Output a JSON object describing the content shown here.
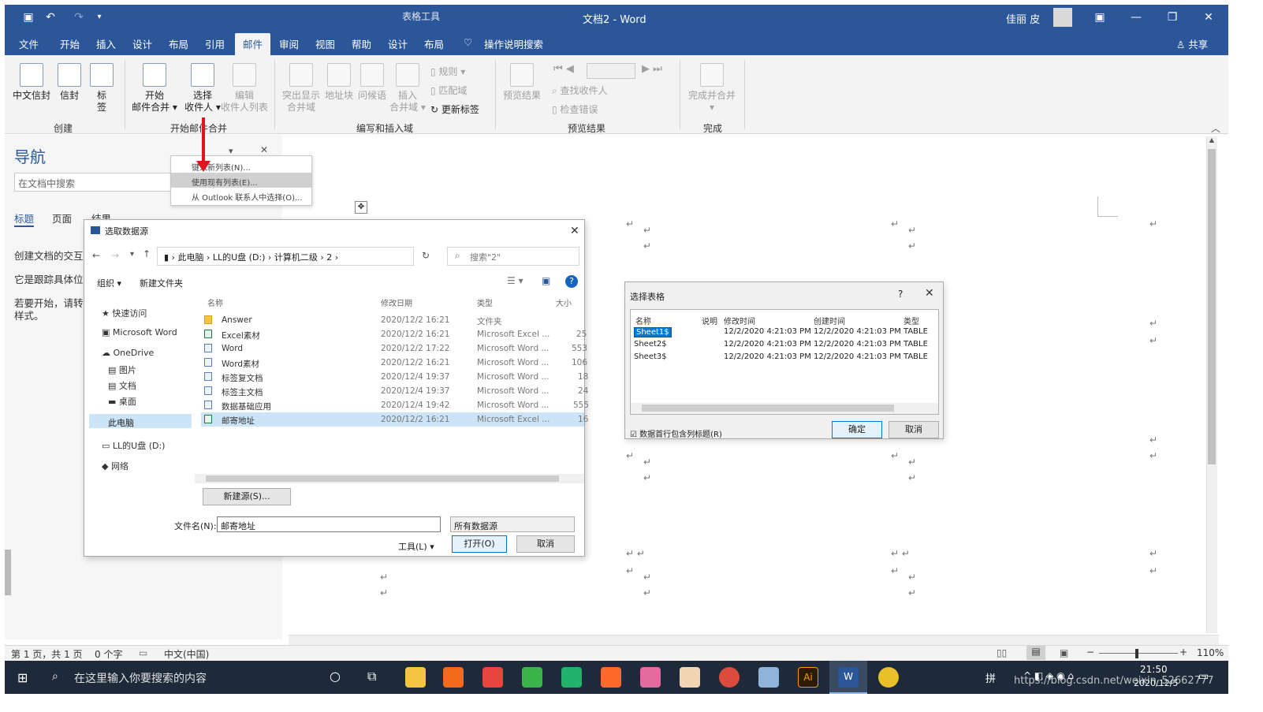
{
  "title_bar": {
    "doc_title": "文档2 - Word",
    "context_tab": "表格工具",
    "user": "佳丽 皮"
  },
  "tabs": [
    "文件",
    "开始",
    "插入",
    "设计",
    "布局",
    "引用",
    "邮件",
    "审阅",
    "视图",
    "帮助",
    "设计",
    "布局"
  ],
  "active_tab": "邮件",
  "tell_me": "操作说明搜索",
  "share": "共享",
  "ribbon": {
    "create": {
      "label": "创建",
      "btn1": "中文信封",
      "btn2": "信封",
      "btn3a": "标",
      "btn3b": "签"
    },
    "start": {
      "label": "开始邮件合并",
      "btn1a": "开始",
      "btn1b": "邮件合并 ▾",
      "btn2a": "选择",
      "btn2b": "收件人 ▾",
      "btn3a": "编辑",
      "btn3b": "收件人列表"
    },
    "write": {
      "label": "编写和插入域",
      "b1a": "突出显示",
      "b1b": "合并域",
      "b2": "地址块",
      "b3": "问候语",
      "b4a": "插入",
      "b4b": "合并域 ▾",
      "rules": "规则 ▾",
      "match": "匹配域",
      "update": "更新标签"
    },
    "preview": {
      "label": "预览结果",
      "btn": "预览结果",
      "find": "查找收件人",
      "check": "检查错误"
    },
    "finish": {
      "label": "完成",
      "btn": "完成并合并"
    }
  },
  "dropdown": {
    "item1": "键入新列表(N)...",
    "item2": "使用现有列表(E)...",
    "item3": "从 Outlook 联系人中选择(O)..."
  },
  "nav": {
    "title": "导航",
    "search_placeholder": "在文档中搜索",
    "tabs": [
      "标题",
      "页面",
      "结果"
    ],
    "text1": "创建文档的交互式",
    "text2": "它是跟踪具体位置",
    "text3a": "若要开始，请转到",
    "text3b": "样式。"
  },
  "open_dialog": {
    "title": "选取数据源",
    "path": [
      "此电脑",
      "LL的U盘 (D:)",
      "计算机二级",
      "2"
    ],
    "search": "搜索\"2\"",
    "organize": "组织 ▾",
    "new_folder": "新建文件夹",
    "sidebar": [
      "快速访问",
      "Microsoft Word",
      "OneDrive",
      "图片",
      "文档",
      "桌面",
      "此电脑",
      "LL的U盘 (D:)",
      "网络"
    ],
    "columns": [
      "名称",
      "修改日期",
      "类型",
      "大小"
    ],
    "files": [
      {
        "name": "Answer",
        "date": "2020/12/2 16:21",
        "type": "文件夹",
        "size": ""
      },
      {
        "name": "Excel素材",
        "date": "2020/12/2 16:21",
        "type": "Microsoft Excel ...",
        "size": "25"
      },
      {
        "name": "Word",
        "date": "2020/12/2 17:22",
        "type": "Microsoft Word ...",
        "size": "553"
      },
      {
        "name": "Word素材",
        "date": "2020/12/2 16:21",
        "type": "Microsoft Word ...",
        "size": "106"
      },
      {
        "name": "标签复文档",
        "date": "2020/12/4 19:37",
        "type": "Microsoft Word ...",
        "size": "18"
      },
      {
        "name": "标签主文档",
        "date": "2020/12/4 19:37",
        "type": "Microsoft Word ...",
        "size": "24"
      },
      {
        "name": "数据基础应用",
        "date": "2020/12/4 19:42",
        "type": "Microsoft Word ...",
        "size": "555"
      },
      {
        "name": "邮寄地址",
        "date": "2020/12/2 16:21",
        "type": "Microsoft Excel ...",
        "size": "16"
      }
    ],
    "new_source_btn": "新建源(S)...",
    "filename_label": "文件名(N):",
    "filename_value": "邮寄地址",
    "filetype": "所有数据源",
    "tools": "工具(L)",
    "open_btn": "打开(O)",
    "cancel_btn": "取消"
  },
  "table_dialog": {
    "title": "选择表格",
    "help": "?",
    "columns": [
      "名称",
      "说明",
      "修改时间",
      "创建时间",
      "类型"
    ],
    "rows": [
      {
        "name": "Sheet1$",
        "modified": "12/2/2020 4:21:03 PM",
        "created": "12/2/2020 4:21:03 PM",
        "type": "TABLE"
      },
      {
        "name": "Sheet2$",
        "modified": "12/2/2020 4:21:03 PM",
        "created": "12/2/2020 4:21:03 PM",
        "type": "TABLE"
      },
      {
        "name": "Sheet3$",
        "modified": "12/2/2020 4:21:03 PM",
        "created": "12/2/2020 4:21:03 PM",
        "type": "TABLE"
      }
    ],
    "checkbox": "数据首行包含列标题(R)",
    "ok": "确定",
    "cancel": "取消"
  },
  "status": {
    "page": "第 1 页，共 1 页",
    "words": "0 个字",
    "lang": "中文(中国)",
    "zoom": "110%"
  },
  "taskbar": {
    "search": "在这里输入你要搜索的内容",
    "time": "21:50",
    "date": "2020/12/5",
    "watermark": "https://blog.csdn.net/weixin_52662777"
  }
}
